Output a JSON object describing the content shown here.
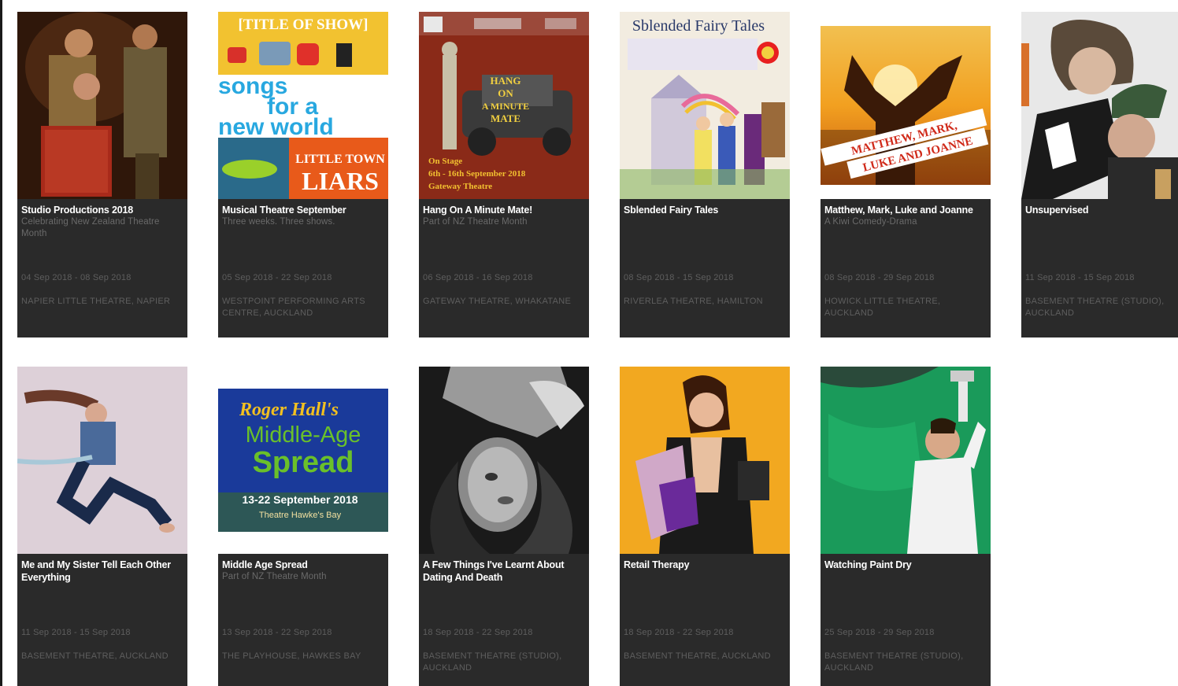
{
  "events": [
    {
      "title": "Studio Productions 2018",
      "subtitle": "Celebrating New Zealand Theatre Month",
      "dates": "04 Sep 2018 - 08 Sep 2018",
      "venue": "NAPIER LITTLE THEATRE, NAPIER"
    },
    {
      "title": "Musical Theatre September",
      "subtitle": "Three weeks. Three shows.",
      "dates": "05 Sep 2018 - 22 Sep 2018",
      "venue": "WESTPOINT PERFORMING ARTS CENTRE, AUCKLAND"
    },
    {
      "title": "Hang On A Minute Mate!",
      "subtitle": "Part of NZ Theatre Month",
      "dates": "06 Sep 2018 - 16 Sep 2018",
      "venue": "GATEWAY THEATRE, WHAKATANE"
    },
    {
      "title": "Sblended Fairy Tales",
      "subtitle": "",
      "dates": "08 Sep 2018 - 15 Sep 2018",
      "venue": "RIVERLEA THEATRE, HAMILTON"
    },
    {
      "title": "Matthew, Mark, Luke and Joanne",
      "subtitle": "A Kiwi Comedy-Drama",
      "dates": "08 Sep 2018 - 29 Sep 2018",
      "venue": "HOWICK LITTLE THEATRE, AUCKLAND"
    },
    {
      "title": "Unsupervised",
      "subtitle": "",
      "dates": "11 Sep 2018 - 15 Sep 2018",
      "venue": "BASEMENT THEATRE (STUDIO), AUCKLAND"
    },
    {
      "title": "Me and My Sister Tell Each Other Everything",
      "subtitle": "",
      "dates": "11 Sep 2018 - 15 Sep 2018",
      "venue": "BASEMENT THEATRE, AUCKLAND"
    },
    {
      "title": "Middle Age Spread",
      "subtitle": "Part of NZ Theatre Month",
      "dates": "13 Sep 2018 - 22 Sep 2018",
      "venue": "THE PLAYHOUSE, HAWKES BAY"
    },
    {
      "title": "A Few Things I've Learnt About Dating And Death",
      "subtitle": "",
      "dates": "18 Sep 2018 - 22 Sep 2018",
      "venue": "BASEMENT THEATRE (STUDIO), AUCKLAND"
    },
    {
      "title": "Retail Therapy",
      "subtitle": "",
      "dates": "18 Sep 2018 - 22 Sep 2018",
      "venue": "BASEMENT THEATRE, AUCKLAND"
    },
    {
      "title": "Watching Paint Dry",
      "subtitle": "",
      "dates": "25 Sep 2018 - 29 Sep 2018",
      "venue": "BASEMENT THEATRE (STUDIO), AUCKLAND"
    }
  ],
  "posters": {
    "p2": {
      "top": "[TITLE OF SHOW]",
      "mid1": "songs",
      "mid2": "for a",
      "mid3": "new world",
      "bottom1": "LITTLE TOWN",
      "bottom2": "LIARS"
    },
    "p3": {
      "title1": "HANG",
      "title2": "ON",
      "title3": "A MINUTE",
      "title4": "MATE",
      "line1": "On Stage",
      "line2": "6th - 16th September 2018",
      "line3": "Gateway Theatre"
    },
    "p4": {
      "title": "Sblended Fairy Tales"
    },
    "p5": {
      "title1": "MATTHEW, MARK,",
      "title2": "LUKE AND JOANNE"
    },
    "p8": {
      "l1": "Roger Hall's",
      "l2": "Middle-Age",
      "l3": "Spread",
      "l4": "13-22 September 2018",
      "l5": "Theatre Hawke's Bay"
    }
  },
  "colors": {
    "card_bg": "#2a2a2a",
    "title": "#ffffff",
    "meta": "#5e5e5e"
  }
}
